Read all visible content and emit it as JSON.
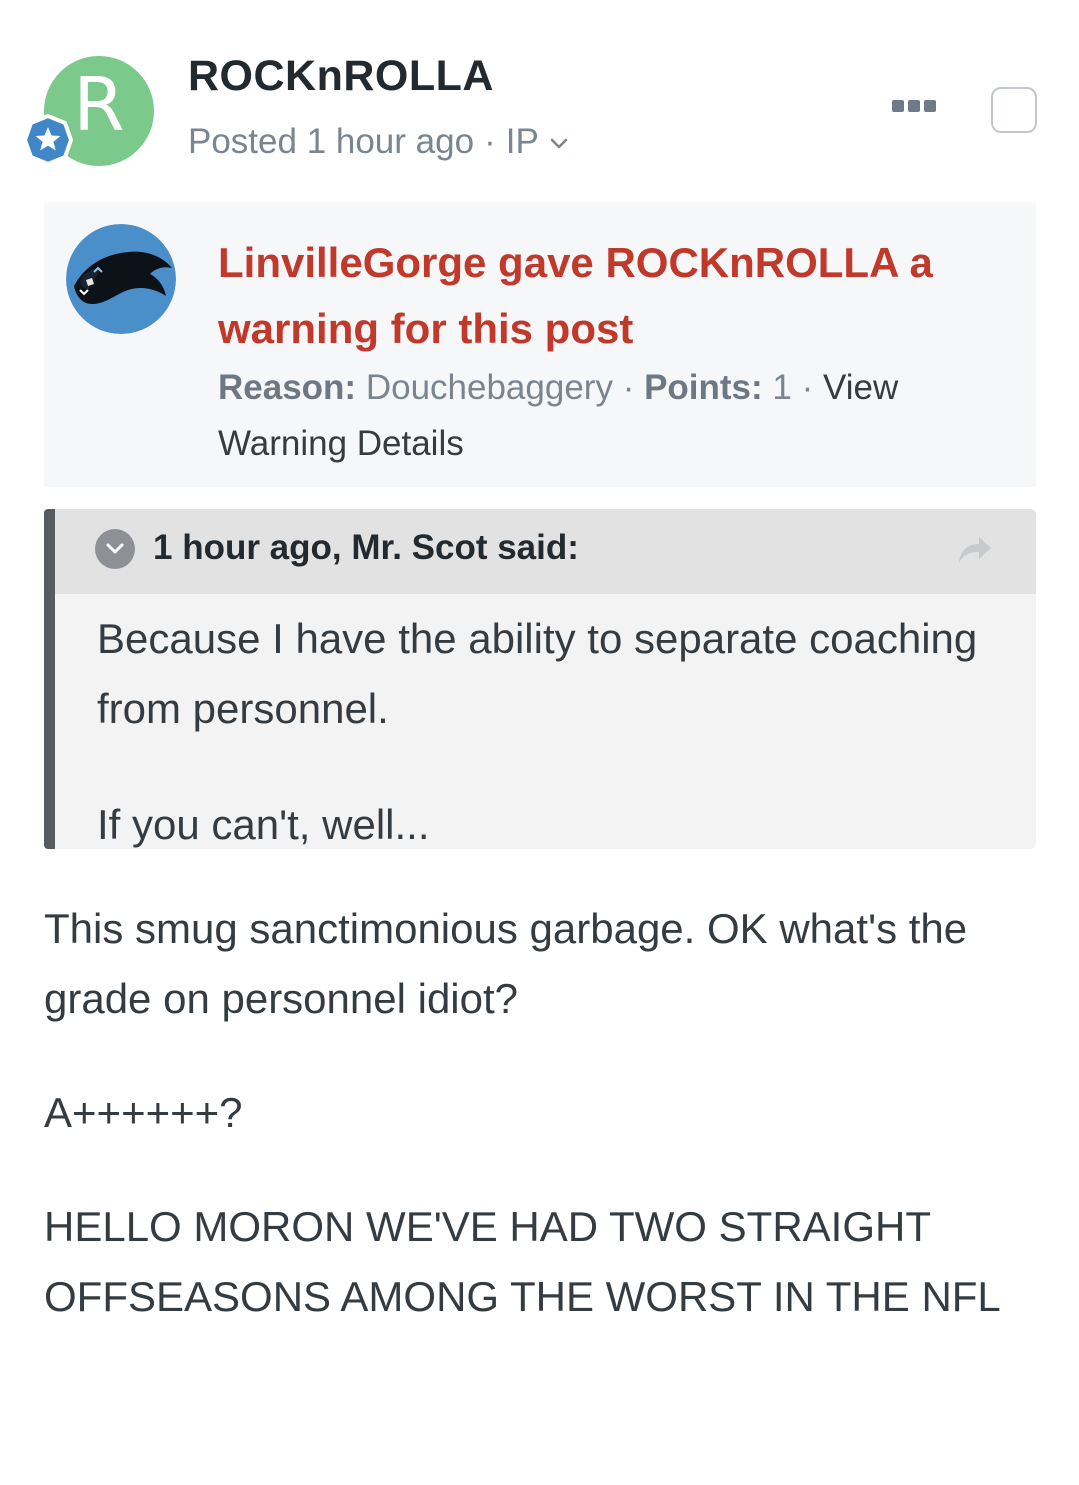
{
  "post": {
    "author": {
      "name": "ROCKnROLLA",
      "avatar_letter": "R",
      "avatar_color": "#7cc98c",
      "badge_color": "#3f87c9"
    },
    "meta": {
      "posted": "Posted 1 hour ago",
      "separator": "·",
      "ip_label": "IP"
    },
    "actions": {
      "more_icon": "ellipsis-icon",
      "select_icon": "checkbox-icon"
    }
  },
  "warning": {
    "title": "LinvilleGorge gave ROCKnROLLA a warning for this post",
    "reason_label": "Reason:",
    "reason_value": "Douchebaggery",
    "separator": "·",
    "points_label": "Points:",
    "points_value": "1",
    "details_link": "View Warning Details",
    "title_color": "#c0392b"
  },
  "quote": {
    "citation": "1 hour ago, Mr. Scot said:",
    "paragraphs": [
      "Because I have the ability to separate coaching from personnel.",
      "If you can't, well..."
    ]
  },
  "body": {
    "paragraphs": [
      "This smug sanctimonious garbage. OK what's the grade on personnel idiot?",
      "A++++++?",
      "HELLO MORON WE'VE HAD TWO STRAIGHT OFFSEASONS AMONG THE WORST IN THE NFL"
    ]
  }
}
